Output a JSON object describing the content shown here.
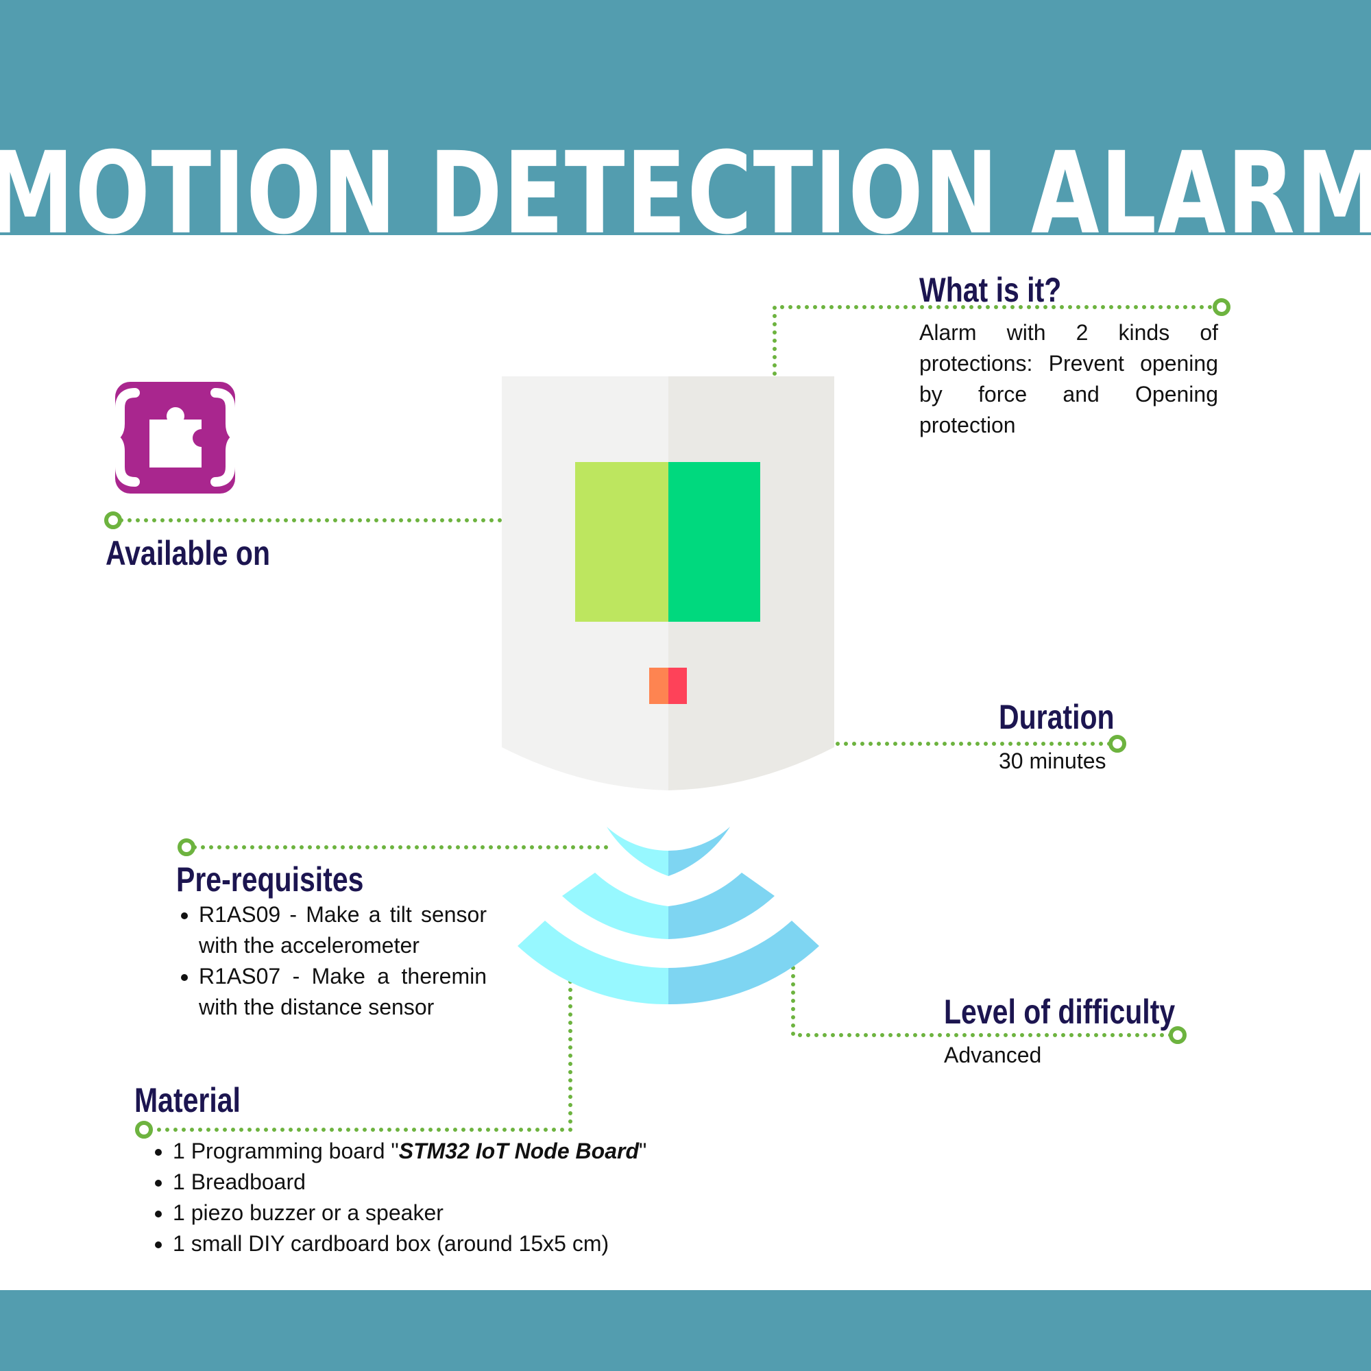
{
  "title": "MOTION DETECTION ALARM",
  "colors": {
    "band": "#539DAF",
    "heading": "#1C1550",
    "text": "#111111",
    "connector": "#6DB33F",
    "logo": "#A9268E",
    "panel_light": "#F2F2F1",
    "panel_dark": "#EAE9E5",
    "screen_left": "#BDE65F",
    "screen_right": "#00D97E",
    "led_left": "#FE8451",
    "led_right": "#FE4259",
    "wave_left": "#97F8FF",
    "wave_right": "#7ED5F2"
  },
  "logo": {
    "icon": "puzzle-braces-icon"
  },
  "what_is_it": {
    "heading": "What is it?",
    "text": "Alarm with 2 kinds of protections: Prevent opening by force and Opening protection"
  },
  "available_on": {
    "heading": "Available on"
  },
  "duration": {
    "heading": "Duration",
    "value": "30 minutes"
  },
  "prerequisites": {
    "heading": "Pre-requisites",
    "items": [
      "R1AS09 - Make a tilt sensor with the accelerometer",
      "R1AS07 - Make a theremin with the distance sensor"
    ]
  },
  "difficulty": {
    "heading": "Level of difficulty",
    "value": "Advanced"
  },
  "material": {
    "heading": "Material",
    "item1_prefix": "1 Programming board \"",
    "item1_board": "STM32 IoT Node Board",
    "item1_suffix": "\"",
    "items": [
      "1 Breadboard",
      "1 piezo buzzer or a speaker",
      "1 small DIY cardboard box (around 15x5 cm)"
    ]
  }
}
